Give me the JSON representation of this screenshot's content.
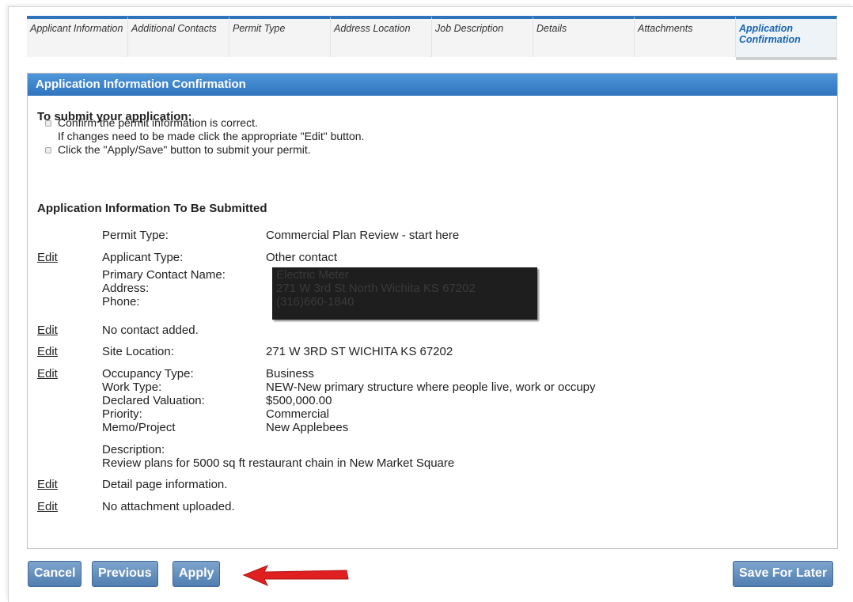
{
  "tabs": [
    {
      "label": "Applicant Information",
      "active": false
    },
    {
      "label": "Additional Contacts",
      "active": false
    },
    {
      "label": "Permit Type",
      "active": false
    },
    {
      "label": "Address Location",
      "active": false
    },
    {
      "label": "Job Description",
      "active": false
    },
    {
      "label": "Details",
      "active": false
    },
    {
      "label": "Attachments",
      "active": false
    },
    {
      "label": "Application Confirmation",
      "active": true
    }
  ],
  "panel": {
    "title": "Application Information Confirmation",
    "instructions_title": "To submit your application:",
    "bullet1_line1": "Confirm the permit information is correct.",
    "bullet1_line2": "If changes need to be made click the appropriate \"Edit\" button.",
    "bullet2": "Click the \"Apply/Save\" button to submit your permit.",
    "section_title": "Application Information To Be Submitted"
  },
  "summary": {
    "edit_label": "Edit",
    "permit_type_label": "Permit Type:",
    "permit_type_value": "Commercial Plan Review - start here",
    "applicant_type_label": "Applicant Type:",
    "applicant_type_value": "Other contact",
    "primary_contact_label": "Primary Contact Name:",
    "primary_contact_value": "Electric Meter",
    "address_label": "Address:",
    "address_value": "271 W 3rd St North Wichita KS 67202",
    "phone_label": "Phone:",
    "phone_value": "(316)660-1840",
    "no_contact": "No contact added.",
    "site_location_label": "Site Location:",
    "site_location_value": "271 W 3RD ST WICHITA KS 67202",
    "occupancy_label": "Occupancy Type:",
    "occupancy_value": "Business",
    "work_type_label": "Work Type:",
    "work_type_value": "NEW-New primary structure where people live, work or occupy",
    "valuation_label": "Declared Valuation:",
    "valuation_value": "$500,000.00",
    "priority_label": "Priority:",
    "priority_value": "Commercial",
    "memo_label": "Memo/Project",
    "memo_value": "New Applebees",
    "description_label": "Description:",
    "description_value": "Review plans for 5000 sq ft restaurant chain in New Market Square",
    "detail_info": "Detail page information.",
    "no_attachment": "No attachment uploaded."
  },
  "buttons": {
    "cancel": "Cancel",
    "previous": "Previous",
    "apply": "Apply",
    "save_later": "Save For Later"
  },
  "colors": {
    "header_blue": "#2f74bd",
    "tab_accent": "#2d74bb",
    "arrow_red": "#e02020"
  }
}
